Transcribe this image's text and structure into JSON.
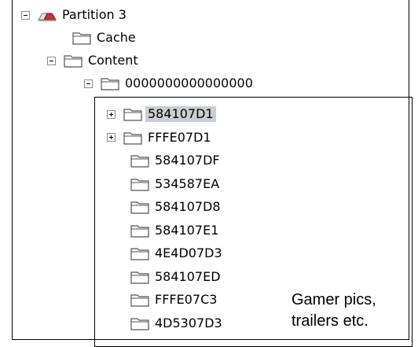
{
  "tree": {
    "partition": {
      "label": "Partition 3",
      "icon": "drive-icon",
      "expanded": true
    },
    "cache": {
      "label": "Cache",
      "icon": "folder-icon"
    },
    "content": {
      "label": "Content",
      "icon": "folder-icon",
      "expanded": true
    },
    "id_folder": {
      "label": "0000000000000000",
      "icon": "folder-icon",
      "expanded": true
    },
    "children": [
      {
        "label": "584107D1",
        "expandable": true,
        "selected": true
      },
      {
        "label": "FFFE07D1",
        "expandable": true,
        "selected": false
      },
      {
        "label": "584107DF",
        "expandable": false,
        "selected": false
      },
      {
        "label": "534587EA",
        "expandable": false,
        "selected": false
      },
      {
        "label": "584107D8",
        "expandable": false,
        "selected": false
      },
      {
        "label": "584107E1",
        "expandable": false,
        "selected": false
      },
      {
        "label": "4E4D07D3",
        "expandable": false,
        "selected": false
      },
      {
        "label": "584107ED",
        "expandable": false,
        "selected": false
      },
      {
        "label": "FFFE07C3",
        "expandable": false,
        "selected": false
      },
      {
        "label": "4D5307D3",
        "expandable": false,
        "selected": false
      }
    ]
  },
  "annotation": {
    "line1": "Gamer pics,",
    "line2": "trailers etc."
  },
  "colors": {
    "selection": "#c9cdd6",
    "drive_red": "#c0342c"
  }
}
